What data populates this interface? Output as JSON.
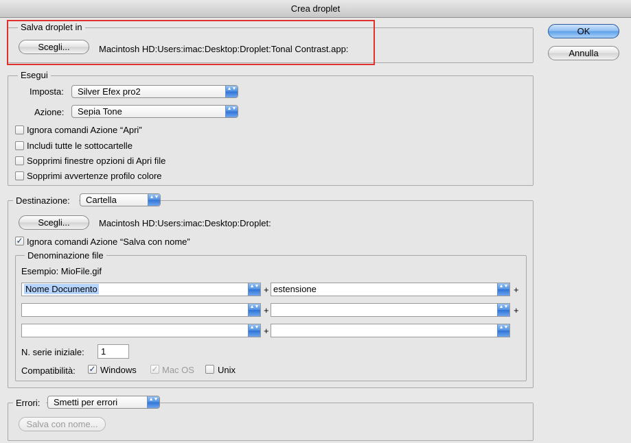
{
  "window": {
    "title": "Crea droplet"
  },
  "buttons": {
    "ok": "OK",
    "cancel": "Annulla"
  },
  "save_in": {
    "legend": "Salva droplet in",
    "choose": "Scegli...",
    "path": "Macintosh HD:Users:imac:Desktop:Droplet:Tonal Contrast.app:"
  },
  "run": {
    "legend": "Esegui",
    "set_label": "Imposta:",
    "set_value": "Silver Efex pro2",
    "action_label": "Azione:",
    "action_value": "Sepia Tone",
    "options": [
      {
        "label": "Ignora comandi Azione “Apri”",
        "checked": false
      },
      {
        "label": "Includi tutte le sottocartelle",
        "checked": false
      },
      {
        "label": "Sopprimi finestre opzioni di Apri file",
        "checked": false
      },
      {
        "label": "Sopprimi avvertenze profilo colore",
        "checked": false
      }
    ]
  },
  "destination": {
    "label": "Destinazione:",
    "value": "Cartella",
    "choose": "Scegli...",
    "path": "Macintosh HD:Users:imac:Desktop:Droplet:",
    "ignore_save": {
      "label": "Ignora comandi Azione “Salva con nome”",
      "checked": true
    },
    "naming": {
      "legend": "Denominazione file",
      "example": "Esempio: MioFile.gif",
      "rows": [
        {
          "left": "Nome Documento",
          "right": "estensione"
        },
        {
          "left": "",
          "right": ""
        },
        {
          "left": "",
          "right": ""
        }
      ],
      "plus": "+",
      "serial_label": "N. serie iniziale:",
      "serial_value": "1",
      "compat_label": "Compatibilità:",
      "compat": [
        {
          "label": "Windows",
          "checked": true,
          "enabled": true
        },
        {
          "label": "Mac OS",
          "checked": true,
          "enabled": false
        },
        {
          "label": "Unix",
          "checked": false,
          "enabled": true
        }
      ]
    }
  },
  "errors": {
    "label": "Errori:",
    "value": "Smetti per errori",
    "save_as": "Salva con nome..."
  },
  "glyphs": {
    "check": "✓",
    "updown": "▲▼"
  },
  "colors": {
    "highlight": "#e0302a",
    "accent": "#4f8fe2"
  }
}
